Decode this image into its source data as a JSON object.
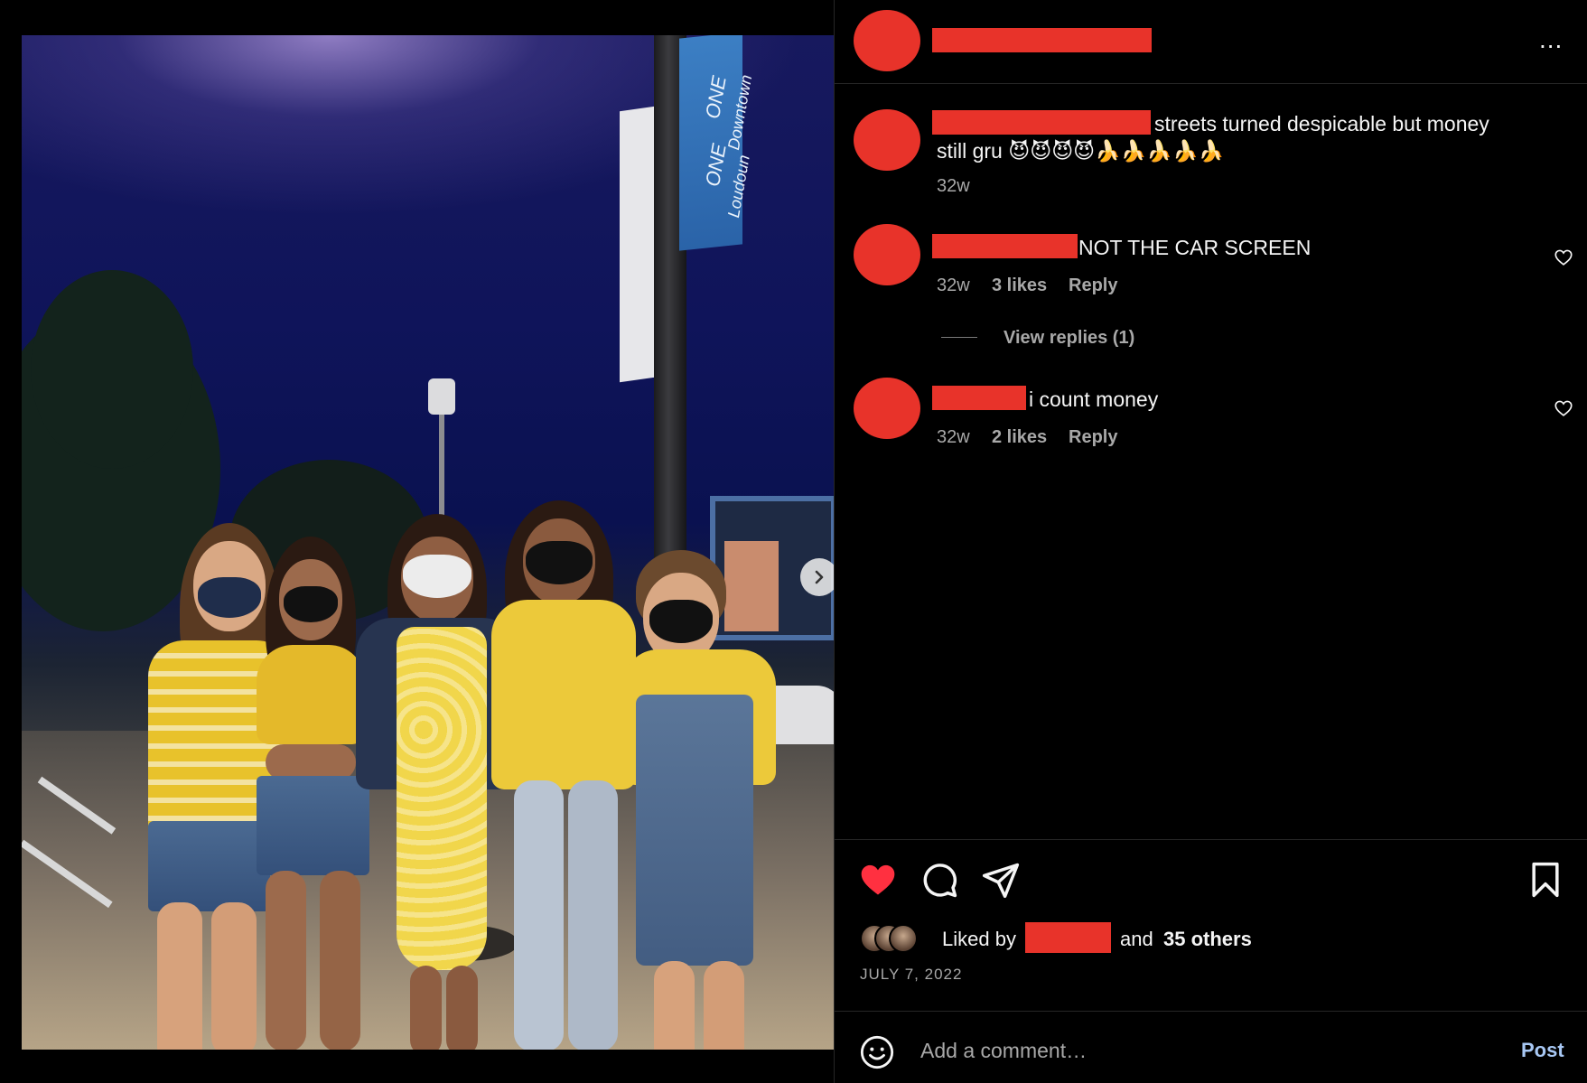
{
  "post": {
    "photo": {
      "banner_line1": "ONE",
      "banner_line2": "Downtown",
      "banner_line3": "ONE",
      "banner_line4": "Loudoun",
      "carousel_dots": 4,
      "active_dot": 1
    },
    "more_options": "...",
    "caption": {
      "line1": "streets turned despicable but money",
      "line2": "still gru 😈😈😈😈🍌🍌🍌🍌🍌",
      "time": "32w"
    },
    "comments": [
      {
        "text": "NOT THE CAR SCREEN",
        "time": "32w",
        "likes": "3 likes",
        "reply": "Reply"
      },
      {
        "text": "i count money",
        "time": "32w",
        "likes": "2 likes",
        "reply": "Reply"
      }
    ],
    "view_replies": "View replies (1)",
    "liked_by_prefix": "Liked by",
    "liked_by_suffix": "and",
    "liked_by_others": "35 others",
    "date": "JULY 7, 2022",
    "add_comment_placeholder": "Add a comment…",
    "post_label": "Post"
  },
  "colors": {
    "redaction": "#e8332a",
    "like_red": "#ff3040",
    "post_blue": "#a8c8f4"
  }
}
